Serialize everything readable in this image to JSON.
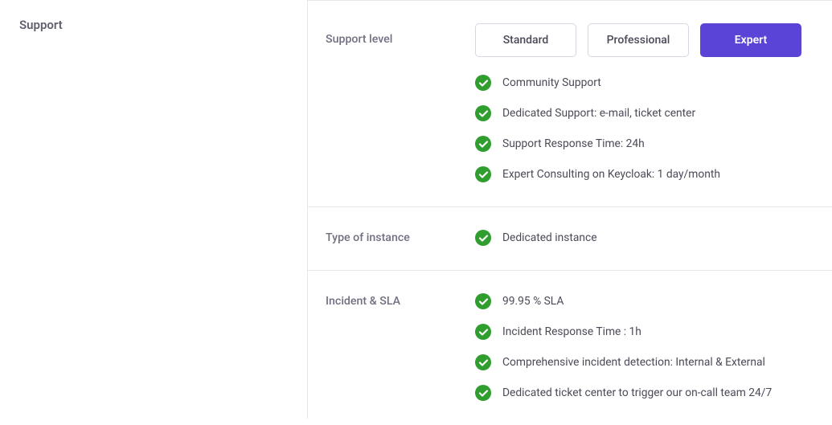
{
  "sidebar": {
    "title": "Support"
  },
  "sections": {
    "support_level": {
      "label": "Support level",
      "plans": [
        "Standard",
        "Professional",
        "Expert"
      ],
      "active_plan_index": 2,
      "features": [
        "Community Support",
        "Dedicated Support: e-mail, ticket center",
        "Support Response Time: 24h",
        "Expert Consulting on Keycloak: 1 day/month"
      ]
    },
    "instance": {
      "label": "Type of instance",
      "features": [
        "Dedicated instance"
      ]
    },
    "sla": {
      "label": "Incident & SLA",
      "features": [
        "99.95 % SLA",
        "Incident Response Time : 1h",
        "Comprehensive incident detection: Internal & External",
        "Dedicated ticket center to trigger our on-call team 24/7"
      ]
    }
  }
}
